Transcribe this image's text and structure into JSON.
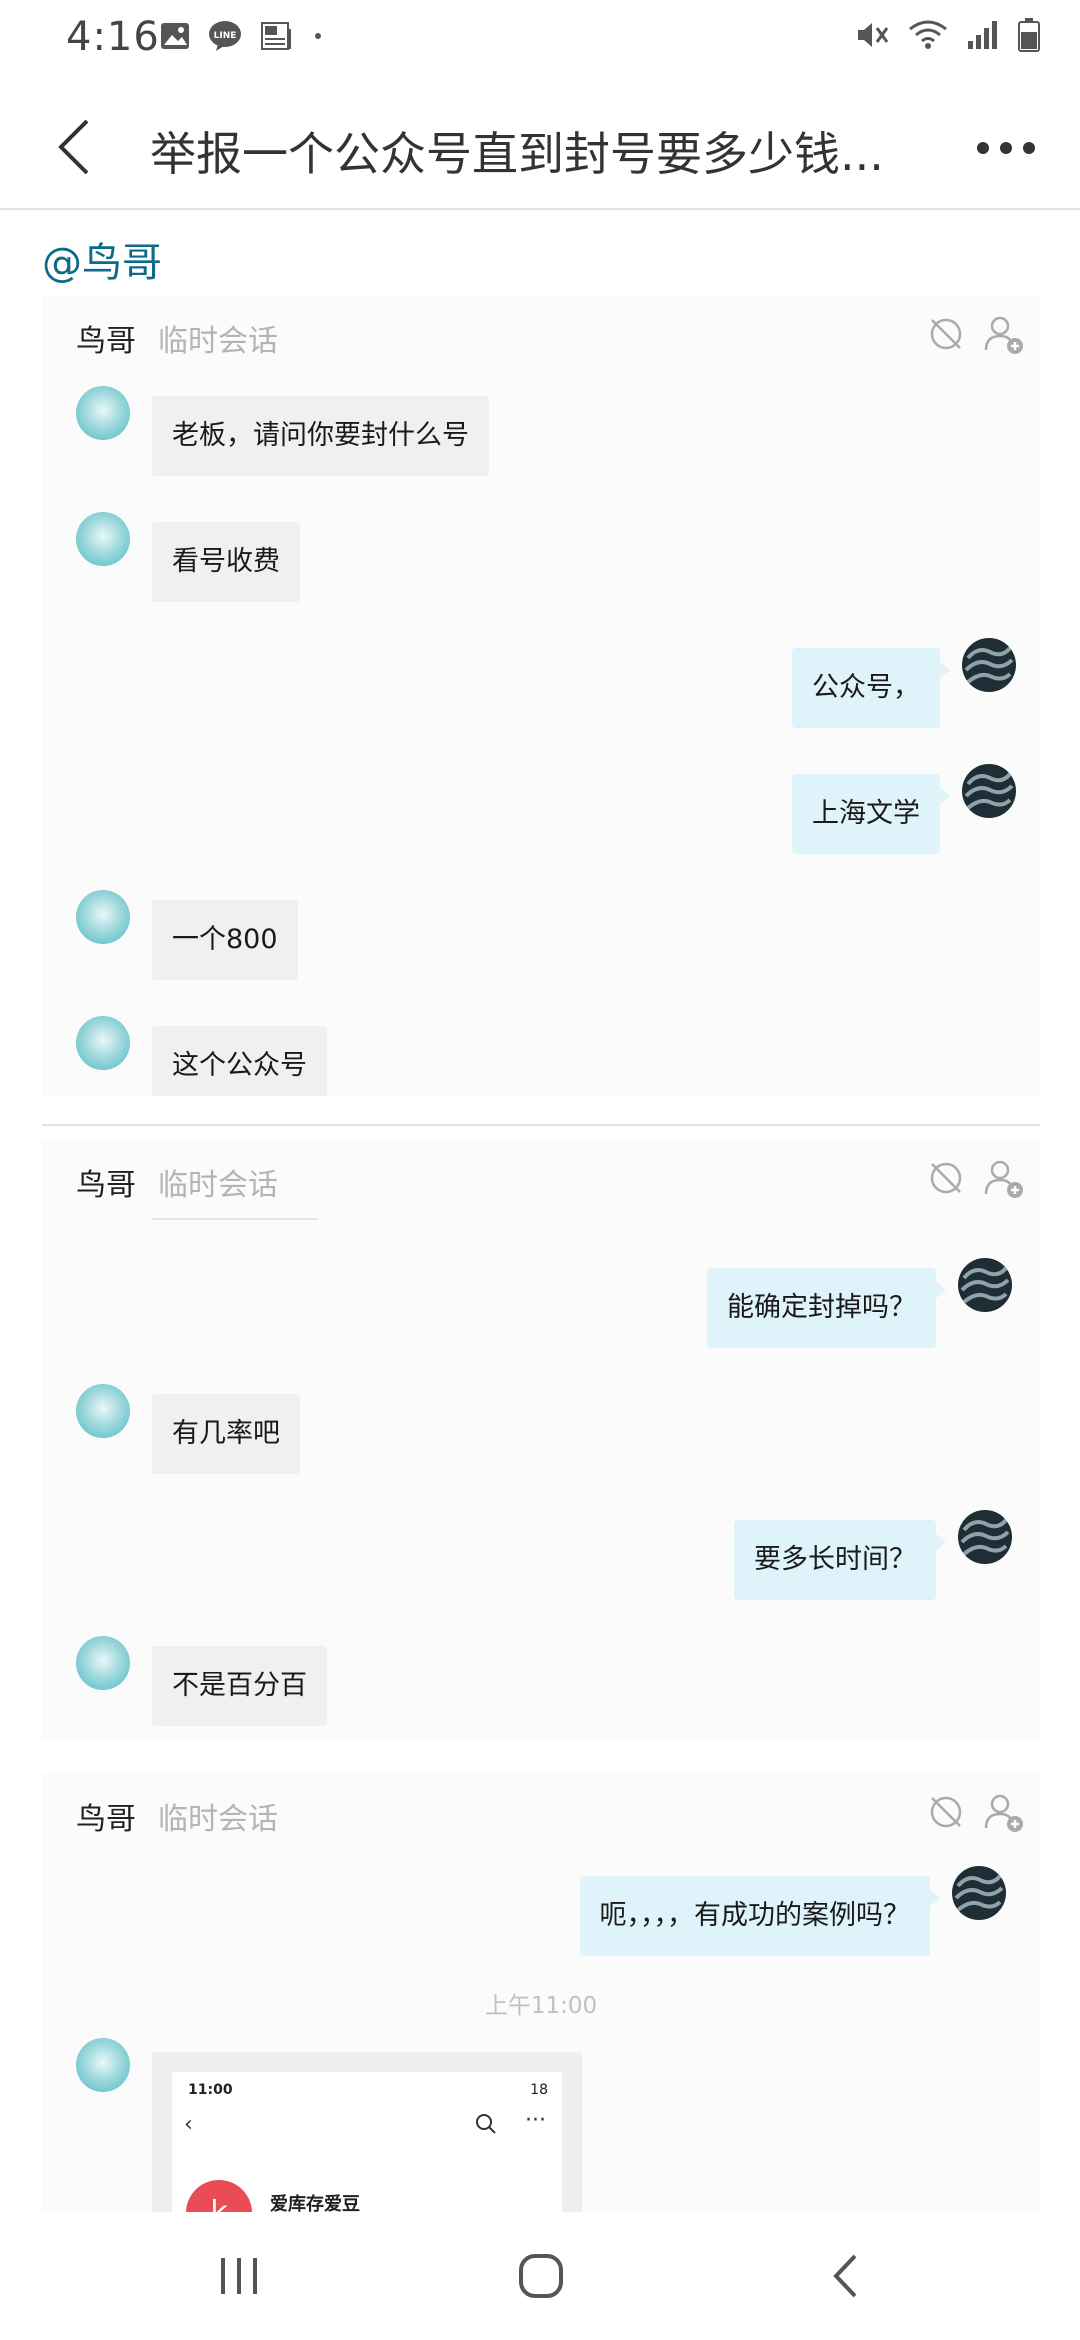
{
  "status_bar": {
    "time": "4:16",
    "left_icons": [
      "gallery-icon",
      "line-app-icon",
      "news-icon",
      "dot-icon"
    ],
    "right_icons": [
      "mute-icon",
      "wifi-icon",
      "signal-icon",
      "battery-icon"
    ]
  },
  "header": {
    "title": "举报一个公众号直到封号要多少钱...",
    "back_icon": "chevron-left-icon",
    "more_icon": "more-horizontal-icon"
  },
  "mention": "@鸟哥",
  "cards": [
    {
      "name": "鸟哥",
      "tag": "临时会话",
      "messages": [
        {
          "from": "them",
          "text": "老板，请问你要封什么号"
        },
        {
          "from": "them",
          "text": "看号收费"
        },
        {
          "from": "me",
          "text": "公众号，"
        },
        {
          "from": "me",
          "text": "上海文学"
        },
        {
          "from": "them",
          "text": "一个800"
        },
        {
          "from": "them",
          "text": "这个公众号"
        }
      ]
    },
    {
      "name": "鸟哥",
      "tag": "临时会话",
      "messages": [
        {
          "from": "me",
          "text": "能确定封掉吗？"
        },
        {
          "from": "them",
          "text": "有几率吧"
        },
        {
          "from": "me",
          "text": "要多长时间？"
        },
        {
          "from": "them",
          "text": "不是百分百"
        }
      ]
    },
    {
      "name": "鸟哥",
      "tag": "临时会话",
      "messages": [
        {
          "from": "me",
          "text": "呃，，，，有成功的案例吗？"
        }
      ],
      "timestamp": "上午11:00",
      "screenshot_preview": {
        "time": "11:00",
        "status": "18",
        "account_name": "爱库存爱豆",
        "logo_letter": "k"
      }
    }
  ],
  "nav": {
    "recent_icon": "recent-apps-icon",
    "home_icon": "home-icon",
    "back_icon": "back-icon"
  },
  "colors": {
    "mention": "#0b6b88",
    "bubble_in": "#f0f0f0",
    "bubble_out": "#dff3fb",
    "card_bg": "#fbfbfb"
  }
}
